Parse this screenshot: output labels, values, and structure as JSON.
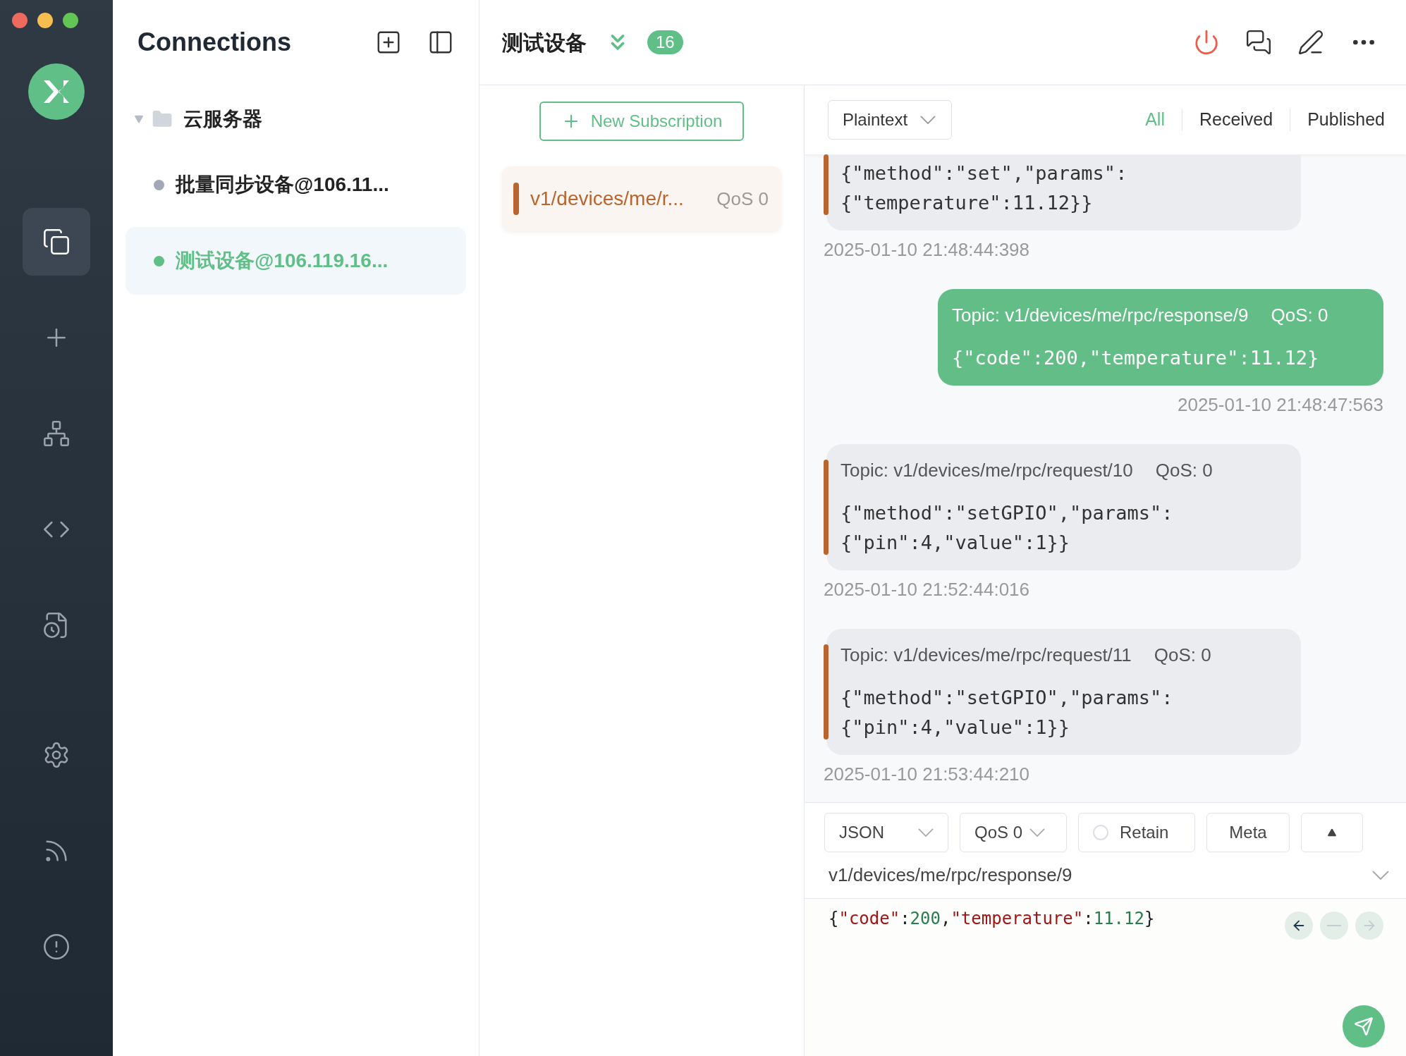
{
  "nav": [
    {
      "kind": "connections",
      "selected": true
    },
    {
      "kind": "new",
      "selected": false
    },
    {
      "kind": "topology",
      "selected": false
    },
    {
      "kind": "script",
      "selected": false
    },
    {
      "kind": "log",
      "selected": false
    },
    {
      "kind": "settings",
      "selected": false
    },
    {
      "kind": "feed",
      "selected": false
    },
    {
      "kind": "about",
      "selected": false
    }
  ],
  "connections_panel": {
    "title": "Connections",
    "groups": [
      {
        "name": "云服务器",
        "expanded": true,
        "children": [
          {
            "name": "批量同步设备@106.11...",
            "color": "#a3a8b8",
            "selected": false
          },
          {
            "name": "测试设备@106.119.16...",
            "color": "#5fbf87",
            "selected": true
          }
        ]
      }
    ]
  },
  "header": {
    "title": "测试设备",
    "badge": "16"
  },
  "subscriptions": {
    "new_button": "New Subscription",
    "items": [
      {
        "topic": "v1/devices/me/r...",
        "qos": "QoS 0",
        "color": "#b8652f"
      }
    ]
  },
  "messages_toolbar": {
    "format": "Plaintext",
    "filters": [
      {
        "label": "All",
        "selected": true
      },
      {
        "label": "Received",
        "selected": false
      },
      {
        "label": "Published",
        "selected": false
      }
    ]
  },
  "messages": [
    {
      "kind": "received",
      "payload": [
        "{\"method\":\"set\",\"params\":",
        "{\"temperature\":11.12}}"
      ],
      "time": "2025-01-10 21:48:44:398"
    },
    {
      "kind": "published",
      "topic": "Topic: v1/devices/me/rpc/response/9",
      "qos": "QoS: 0",
      "payload": [
        "{\"code\":200,\"temperature\":11.12}"
      ],
      "time": "2025-01-10 21:48:47:563"
    },
    {
      "kind": "received",
      "topic": "Topic: v1/devices/me/rpc/request/10",
      "qos": "QoS: 0",
      "payload": [
        "{\"method\":\"setGPIO\",\"params\":",
        "{\"pin\":4,\"value\":1}}"
      ],
      "time": "2025-01-10 21:52:44:016"
    },
    {
      "kind": "received",
      "topic": "Topic: v1/devices/me/rpc/request/11",
      "qos": "QoS: 0",
      "payload": [
        "{\"method\":\"setGPIO\",\"params\":",
        "{\"pin\":4,\"value\":1}}"
      ],
      "time": "2025-01-10 21:53:44:210"
    }
  ],
  "composer": {
    "format": "JSON",
    "qos": "QoS 0",
    "retain": {
      "label": "Retain",
      "checked": false
    },
    "meta": "Meta",
    "topic": "v1/devices/me/rpc/response/9",
    "payload": [
      {
        "kind": "punct",
        "text": "{"
      },
      {
        "kind": "string",
        "text": "\"code\""
      },
      {
        "kind": "punct",
        "text": ":"
      },
      {
        "kind": "number",
        "text": "200"
      },
      {
        "kind": "punct",
        "text": ","
      },
      {
        "kind": "string",
        "text": "\"temperature\""
      },
      {
        "kind": "punct",
        "text": ":"
      },
      {
        "kind": "number",
        "text": "11.12"
      },
      {
        "kind": "punct",
        "text": "}"
      }
    ]
  }
}
